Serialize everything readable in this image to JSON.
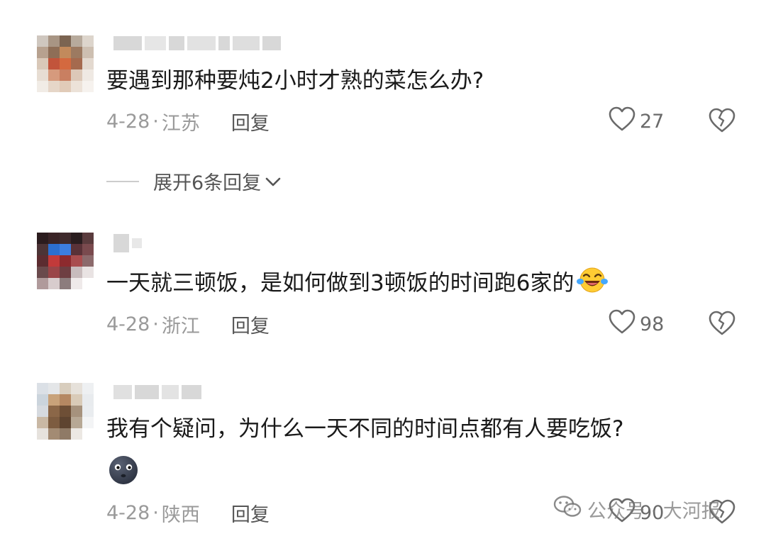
{
  "comments": [
    {
      "text": "要遇到那种要炖2小时才熟的菜怎么办?",
      "date": "4-28",
      "separator": "·",
      "location": "江苏",
      "reply_label": "回复",
      "likes": "27",
      "expand_label": "展开6条回复"
    },
    {
      "text": "一天就三顿饭，是如何做到3顿饭的时间跑6家的",
      "date": "4-28",
      "separator": "·",
      "location": "浙江",
      "reply_label": "回复",
      "likes": "98"
    },
    {
      "text": "我有个疑问，为什么一天不同的时间点都有人要吃饭?",
      "date": "4-28",
      "separator": "·",
      "location": "陕西",
      "reply_label": "回复",
      "likes": "90"
    }
  ],
  "watermark": {
    "text": "公众号 · 大河报"
  },
  "icons": {
    "like": "heart-outline-icon",
    "dislike": "broken-heart-icon",
    "expand": "chevron-down-icon",
    "laugh_emoji": "laughing-crying-emoji",
    "wechat": "wechat-icon"
  },
  "colors": {
    "text": "#1a1a1a",
    "meta": "#9a9a9a",
    "reply": "#555555"
  }
}
